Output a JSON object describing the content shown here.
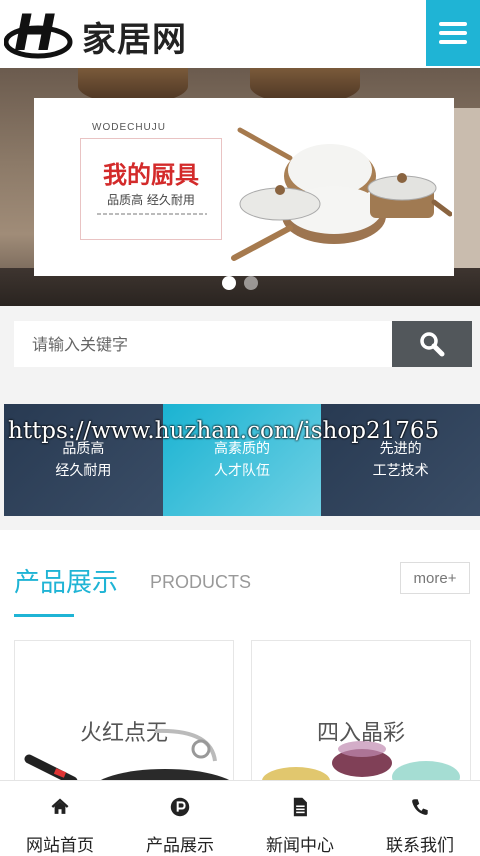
{
  "header": {
    "logo_mark": "H",
    "site_name": "家居网",
    "menu_icon": "hamburger-menu-icon",
    "accent_color": "#1fb4d5"
  },
  "banner": {
    "brand_pinyin": "WODECHUJU",
    "headline": "我的厨具",
    "slogan": "品质高 经久耐用",
    "slide_count": 2,
    "active_slide": 1
  },
  "search": {
    "placeholder": "请输入关键字",
    "button_icon": "search-icon"
  },
  "features": [
    {
      "line1": "品质高",
      "line2": "经久耐用"
    },
    {
      "line1": "高素质的",
      "line2": "人才队伍"
    },
    {
      "line1": "先进的",
      "line2": "工艺技术"
    }
  ],
  "watermark": "https://www.huzhan.com/ishop21765",
  "products": {
    "title": "产品展示",
    "subtitle": "PRODUCTS",
    "more_label": "more+",
    "items": [
      {
        "name": "火红点无"
      },
      {
        "name": "四入晶彩"
      }
    ]
  },
  "bottom_nav": [
    {
      "label": "网站首页",
      "icon": "home-icon"
    },
    {
      "label": "产品展示",
      "icon": "product-p-icon"
    },
    {
      "label": "新闻中心",
      "icon": "document-icon"
    },
    {
      "label": "联系我们",
      "icon": "phone-icon"
    }
  ]
}
